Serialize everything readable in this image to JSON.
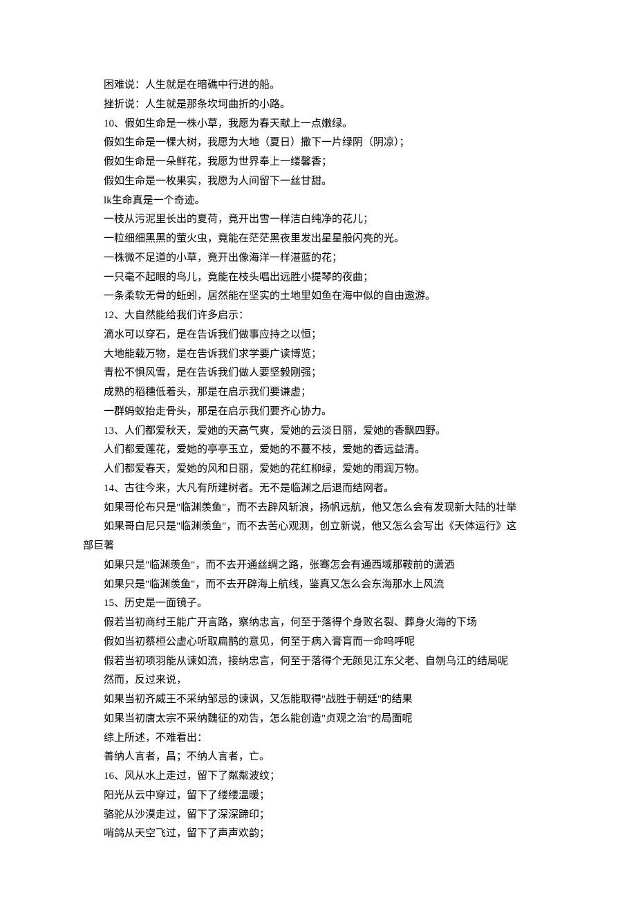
{
  "lines": [
    "困难说：人生就是在暗礁中行进的船。",
    "挫折说：人生就是那条坎坷曲折的小路。",
    "10、假如生命是一株小草，我愿为春天献上一点嫩绿。",
    "假如生命是一棵大树，我愿为大地（夏日）撒下一片绿阴（阴凉）；",
    "假如生命是一朵鲜花，我愿为世界奉上一缕馨香；",
    "假如生命是一枚果实，我愿为人间留下一丝甘甜。",
    "lk生命真是一个奇迹。",
    "一枝从污泥里长出的夏荷，竟开出雪一样洁白纯净的花儿；",
    "一粒细细黑黑的萤火虫，竟能在茫茫黑夜里发出星星般闪亮的光。",
    "一株微不足道的小草，竟开出像海洋一样湛蓝的花；",
    "一只毫不起眼的鸟儿，竟能在枝头唱出远胜小提琴的夜曲；",
    "一条柔软无骨的蚯蚓，居然能在坚实的土地里如鱼在海中似的自由遨游。",
    "12、大自然能给我们许多启示：",
    "滴水可以穿石，是在告诉我们做事应持之以恒；",
    "大地能载万物，是在告诉我们求学要广读博览；",
    "青松不惧风雪，是在告诉我们做人要坚毅刚强；",
    "成熟的稻穗低着头，那是在启示我们要谦虚；",
    "一群蚂蚁抬走骨头，那是在启示我们要齐心协力。",
    "13、人们都爱秋天，爱她的天高气爽，爱她的云淡日丽，爱她的香飘四野。",
    "人们都爱莲花，爱她的亭亭玉立，爱她的不蔓不枝，爱她的香远益清。",
    "人们都爱春天，爱她的风和日丽，爱她的花红柳绿，爱她的雨润万物。",
    "14、古往今来，大凡有所建树者。无不是临渊之后退而结网者。",
    "如果哥伦布只是\"临渊羡鱼\"，而不去辟风斩浪，扬帆远航，他又怎么会有发现新大陆的壮举",
    "如果哥白尼只是\"临渊羡鱼\"，而不去苦心观测，创立新说，他又怎么会写出《天体运行》这",
    "如果只是\"临渊羡鱼\"，而不去开通丝绸之路，张骞怎会有通西域那鞍前的潇洒",
    "如果只是\"临渊羡鱼\"，而不去开辟海上航线，鉴真又怎么会东海那水上风流",
    "15、历史是一面镜子。",
    "假若当初商纣王能广开言路，察纳忠言，何至于落得个身败名裂、葬身火海的下场",
    "假如当初蔡桓公虚心听取扁鹊的意见，何至于病入膏肓而一命呜呼呢",
    "假若当初项羽能从谏如流，接纳忠言，何至于落得个无颜见江东父老、自刎乌江的结局呢",
    "然而，反过来说，",
    "如果当初齐威王不采纳邹忌的谏讽，又怎能取得\"战胜于朝廷''的结果",
    "如果当初唐太宗不采纳魏征的劝告，怎么能创造\"贞观之治''的局面呢",
    "综上所述，不难看出：",
    "善纳人言者，昌；不纳人言者，亡。",
    "16、风从水上走过，留下了粼粼波纹；",
    "阳光从云中穿过，留下了缕缕温暖；",
    "骆驼从沙漠走过，留下了深深蹄印；",
    "哨鸽从天空飞过，留下了声声欢韵；"
  ],
  "wrapLine": "部巨著"
}
